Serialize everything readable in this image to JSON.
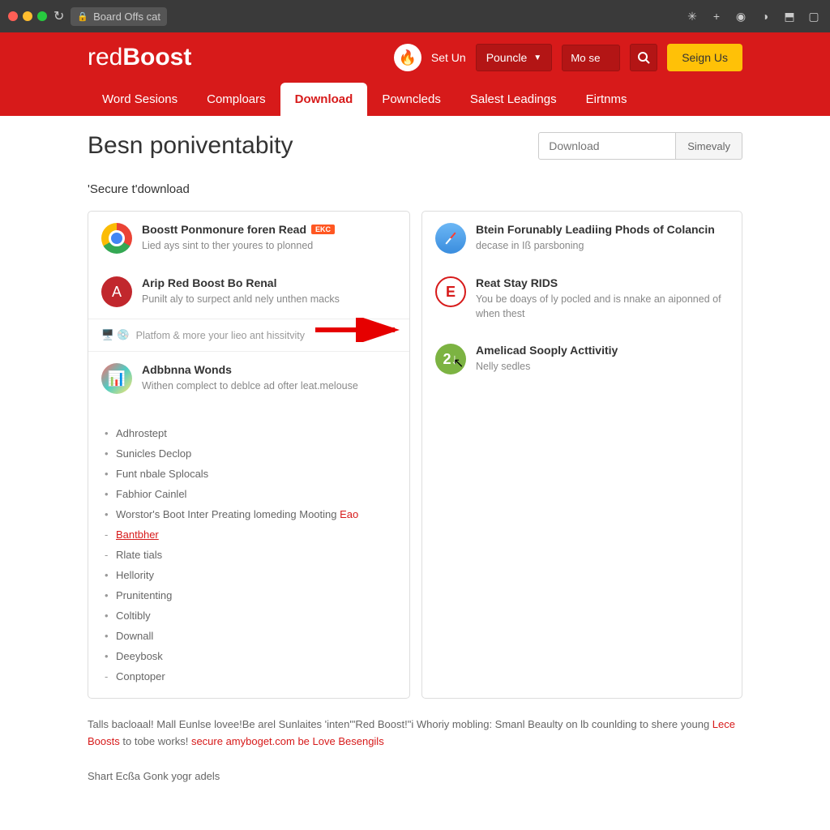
{
  "browser": {
    "url": "Board Offs cat"
  },
  "header": {
    "logo_red": "red",
    "logo_boost": "Boost",
    "set_un": "Set Un",
    "dropdown": "Pouncle",
    "search_placeholder": "Mo se",
    "signup": "Seign Us"
  },
  "nav": {
    "tabs": [
      "Word Sesions",
      "Comploars",
      "Download",
      "Powncleds",
      "Salest Leadings",
      "Eirtnms"
    ],
    "active_index": 2
  },
  "page": {
    "title": "Besn poniventabity",
    "search_placeholder": "Download",
    "search_button": "Simevaly",
    "secure_download": "'Secure t'download"
  },
  "left_card": {
    "items": [
      {
        "title": "Boostt Ponmonure foren Read",
        "badge": "EKC",
        "desc": "Lied ays sint to ther youres to plonned"
      },
      {
        "title": "Arip Red Boost Bo Renal",
        "desc": "Punilt aly to surpect anld nely unthen macks"
      }
    ],
    "platform": "Platfom & more your lieo ant hissitvity",
    "section3": {
      "title": "Adbbnna Wonds",
      "desc": "Withen complect to deblce ad ofter leat.melouse"
    },
    "list": [
      "Adhrostept",
      "Sunicles Declop",
      "Funt nbale Splocals",
      "Fabhior Cainlel",
      "Worstor's Boot Inter Preating lomeding Mooting",
      "Bantbher",
      "Rlate tials",
      "Hellority",
      "Prunitenting",
      "Coltibly",
      "Downall",
      "Deeybosk",
      "Conptoper"
    ],
    "list_eao": "Eao"
  },
  "right_card": {
    "items": [
      {
        "title": "Btein Forunably Leadiing Phods of Colancin",
        "desc": "decase in Iß parsboning"
      },
      {
        "title": "Reat Stay RIDS",
        "desc": "You be doays of ly pocled and is nnake an aiponned of when thest"
      },
      {
        "title": "Amelicad Sooply Acttivitiy",
        "desc": "Nelly sedles"
      }
    ]
  },
  "footer": {
    "text1": "Talls bacloaal! Mall Eunlse lovee!Be arel Sunlaites 'inten\"'Red Boost!\"i Whoriy mobling: Smanl Beaulty on lb counlding to shere young",
    "link1": "Lece Boosts",
    "text2": "to tobe works!",
    "link2": "secure amyboget.com be",
    "link3": "Love Besengils",
    "share": "Shart Ecßa Gonk yogr adels"
  }
}
